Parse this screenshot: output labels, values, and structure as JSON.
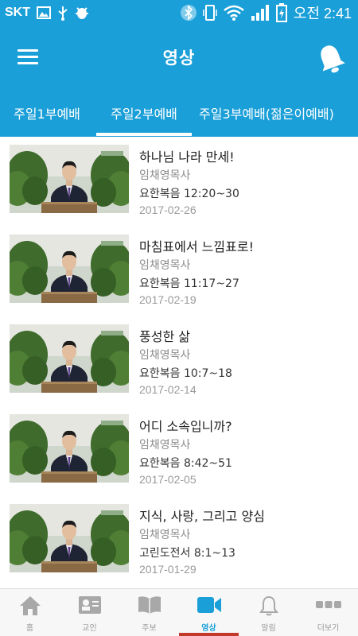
{
  "status_bar": {
    "carrier": "SKT",
    "time": "오전 2:41",
    "icons": [
      "gallery-icon",
      "usb-icon",
      "android-debug-icon",
      "bluetooth-icon",
      "vibrate-icon",
      "wifi-icon",
      "signal-icon",
      "battery-icon"
    ]
  },
  "app_bar": {
    "title": "영상",
    "menu_icon": "hamburger-menu-icon",
    "action_icon": "bell-icon"
  },
  "tabs": [
    {
      "label": "주일1부예배"
    },
    {
      "label": "주일2부예배",
      "selected": true
    },
    {
      "label": "주일3부예배(젊은이예배)"
    }
  ],
  "videos": [
    {
      "title": "하나님 나라 만세!",
      "preacher": "임채영목사",
      "scripture": "요한복음 12:20~30",
      "date": "2017-02-26"
    },
    {
      "title": "마침표에서 느낌표로!",
      "preacher": "임채영목사",
      "scripture": "요한복음 11:17~27",
      "date": "2017-02-19"
    },
    {
      "title": "풍성한 삶",
      "preacher": "임채영목사",
      "scripture": "요한복음 10:7~18",
      "date": "2017-02-14"
    },
    {
      "title": "어디 소속입니까?",
      "preacher": "임채영목사",
      "scripture": "요한복음 8:42~51",
      "date": "2017-02-05"
    },
    {
      "title": "지식, 사랑, 그리고 양심",
      "preacher": "임채영목사",
      "scripture": "고린도전서 8:1~13",
      "date": "2017-01-29"
    }
  ],
  "bottom_nav": [
    {
      "label": "홈",
      "icon": "home-icon"
    },
    {
      "label": "교인",
      "icon": "member-card-icon"
    },
    {
      "label": "주보",
      "icon": "bulletin-book-icon"
    },
    {
      "label": "영상",
      "icon": "video-camera-icon",
      "active": true
    },
    {
      "label": "알림",
      "icon": "bell-outline-icon"
    },
    {
      "label": "더보기",
      "icon": "more-dots-icon"
    }
  ],
  "colors": {
    "primary": "#1a9fd8",
    "active_underline": "#c0392b",
    "nav_inactive": "#999999"
  }
}
